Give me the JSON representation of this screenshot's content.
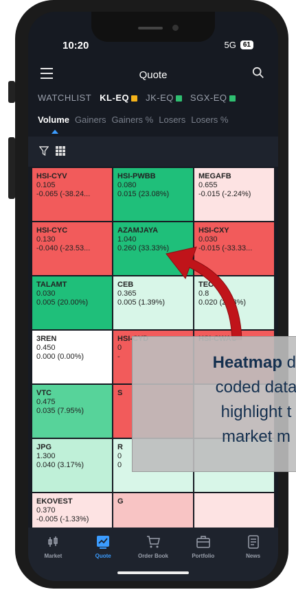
{
  "status_bar": {
    "time": "10:20",
    "network": "5G",
    "battery": "61"
  },
  "header": {
    "title": "Quote"
  },
  "exchange_tabs": [
    {
      "label": "WATCHLIST",
      "active": false
    },
    {
      "label": "KL-EQ",
      "active": true,
      "badge_color": "#f5b31a"
    },
    {
      "label": "JK-EQ",
      "active": false,
      "badge_color": "#2fbf71"
    },
    {
      "label": "SGX-EQ",
      "active": false,
      "badge_color": "#2fbf71"
    }
  ],
  "sort_tabs": [
    {
      "label": "Volume",
      "active": true
    },
    {
      "label": "Gainers",
      "active": false
    },
    {
      "label": "Gainers %",
      "active": false
    },
    {
      "label": "Losers",
      "active": false
    },
    {
      "label": "Losers %",
      "active": false
    }
  ],
  "heatmap": [
    {
      "symbol": "HSI-CYV",
      "price": "0.105",
      "change": "-0.065 (-38.24...",
      "color": "#f25b5b"
    },
    {
      "symbol": "HSI-PWBB",
      "price": "0.080",
      "change": "0.015 (23.08%)",
      "color": "#1fbf7a"
    },
    {
      "symbol": "MEGAFB",
      "price": "0.655",
      "change": "-0.015 (-2.24%)",
      "color": "#fde3e3"
    },
    {
      "symbol": "HSI-CYC",
      "price": "0.130",
      "change": "-0.040 (-23.53...",
      "color": "#f25b5b"
    },
    {
      "symbol": "AZAMJAYA",
      "price": "1.040",
      "change": "0.260 (33.33%)",
      "color": "#1fbf7a"
    },
    {
      "symbol": "HSI-CXY",
      "price": "0.030",
      "change": "-0.015 (-33.33...",
      "color": "#f25b5b"
    },
    {
      "symbol": "TALAMT",
      "price": "0.030",
      "change": "0.005 (20.00%)",
      "color": "#1fbf7a"
    },
    {
      "symbol": "CEB",
      "price": "0.365",
      "change": "0.005 (1.39%)",
      "color": "#d8f6e8"
    },
    {
      "symbol": "TEC",
      "price": "0.8",
      "change": "0.020 (2.33%)",
      "color": "#d8f6e8"
    },
    {
      "symbol": "3REN",
      "price": "0.450",
      "change": "0.000 (0.00%)",
      "color": "#ffffff"
    },
    {
      "symbol": "HSI-CYD",
      "price": "0",
      "change": "-",
      "color": "#f25b5b"
    },
    {
      "symbol": "HSI-CWAO",
      "price": "",
      "change": "",
      "color": "#f25b5b"
    },
    {
      "symbol": "VTC",
      "price": "0.475",
      "change": "0.035 (7.95%)",
      "color": "#57d39a"
    },
    {
      "symbol": "S",
      "price": "",
      "change": "",
      "color": "#f25b5b"
    },
    {
      "symbol": "",
      "price": "",
      "change": "",
      "color": "#f8c4c4"
    },
    {
      "symbol": "JPG",
      "price": "1.300",
      "change": "0.040 (3.17%)",
      "color": "#bff0d8"
    },
    {
      "symbol": "R",
      "price": "0",
      "change": "0",
      "color": "#d8f6e8"
    },
    {
      "symbol": "",
      "price": "",
      "change": "",
      "color": "#d8f6e8"
    },
    {
      "symbol": "EKOVEST",
      "price": "0.370",
      "change": "-0.005 (-1.33%)",
      "color": "#fde3e3"
    },
    {
      "symbol": "G",
      "price": "",
      "change": "",
      "color": "#f8c4c4"
    },
    {
      "symbol": "",
      "price": "",
      "change": "",
      "color": "#fde3e3"
    }
  ],
  "bottom_nav": [
    {
      "label": "Market",
      "icon": "market-icon",
      "active": false
    },
    {
      "label": "Quote",
      "icon": "quote-chart-icon",
      "active": true
    },
    {
      "label": "Order Book",
      "icon": "cart-icon",
      "active": false
    },
    {
      "label": "Portfolio",
      "icon": "briefcase-icon",
      "active": false
    },
    {
      "label": "News",
      "icon": "news-icon",
      "active": false
    }
  ],
  "callout": {
    "bold_word": "Heatmap",
    "line1_rest": " di",
    "line2": "coded data",
    "line3": "highlight t",
    "line4": "market m"
  }
}
